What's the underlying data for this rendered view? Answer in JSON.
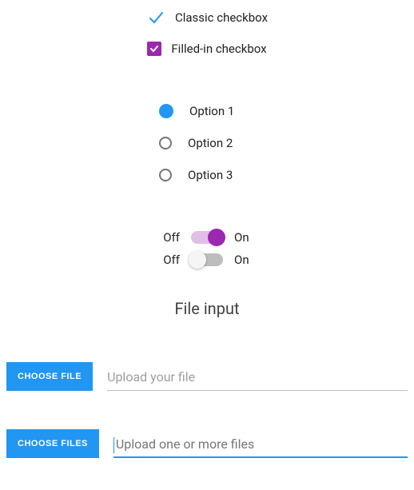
{
  "checkboxes": {
    "classic_label": "Classic checkbox",
    "filled_label": "Filled-in checkbox"
  },
  "radios": {
    "option1": "Option 1",
    "option2": "Option 2",
    "option3": "Option 3"
  },
  "switches": {
    "off_label": "Off",
    "on_label": "On"
  },
  "file": {
    "heading": "File input",
    "choose_file_btn": "CHOOSE FILE",
    "choose_files_btn": "CHOOSE FILES",
    "placeholder_single": "Upload your file",
    "placeholder_multi": "Upload one or more files"
  },
  "colors": {
    "accent_blue": "#2196f3",
    "accent_purple": "#9c27b0"
  }
}
